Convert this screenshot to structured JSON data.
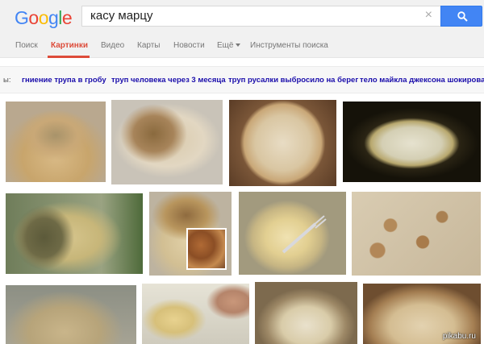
{
  "header": {
    "logo_letters": [
      "G",
      "o",
      "o",
      "g",
      "l",
      "e"
    ],
    "logo_colors": [
      "#4285f4",
      "#ea4335",
      "#fbbc05",
      "#4285f4",
      "#34a853",
      "#ea4335"
    ],
    "search_query": "касу марцу",
    "clear_symbol": "×"
  },
  "tabs": {
    "search": "Поиск",
    "images": "Картинки",
    "video": "Видео",
    "maps": "Карты",
    "news": "Новости",
    "more": "Ещё",
    "tools": "Инструменты поиска"
  },
  "related": {
    "cut_prefix": "ы:",
    "chips": [
      "гниение трупа в гробу",
      "труп человека через 3 месяца",
      "труп русалки выбросило на берег",
      "тело майкла джексона шокирова"
    ]
  },
  "images": {
    "count": 12,
    "watermark": "pikabu.ru"
  },
  "colors": {
    "accent": "#dd4b39",
    "link": "#1a0dab",
    "search_button": "#4285f4"
  }
}
